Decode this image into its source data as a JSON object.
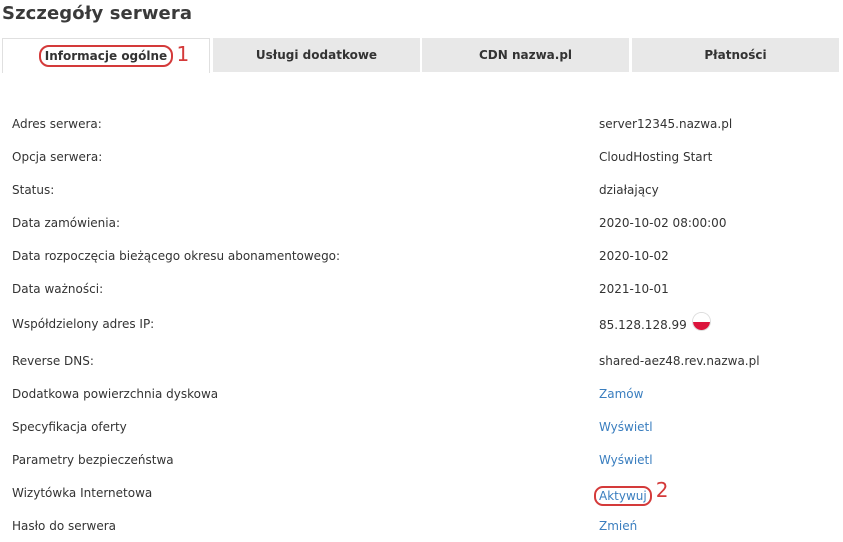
{
  "page_title": "Szczegóły serwera",
  "tabs": [
    {
      "label": "Informacje ogólne",
      "active": true,
      "marker": "1"
    },
    {
      "label": "Usługi dodatkowe",
      "active": false
    },
    {
      "label": "CDN nazwa.pl",
      "active": false
    },
    {
      "label": "Płatności",
      "active": false
    }
  ],
  "rows": [
    {
      "label": "Adres serwera:",
      "value": "server12345.nazwa.pl"
    },
    {
      "label": "Opcja serwera:",
      "value": "CloudHosting Start"
    },
    {
      "label": "Status:",
      "value": "działający"
    },
    {
      "label": "Data zamówienia:",
      "value": "2020-10-02 08:00:00"
    },
    {
      "label": "Data rozpoczęcia bieżącego okresu abonamentowego:",
      "value": "2020-10-02"
    },
    {
      "label": "Data ważności:",
      "value": "2021-10-01"
    },
    {
      "label": "Współdzielony adres IP:",
      "value": "85.128.128.99",
      "flag_icon": "poland-flag-icon"
    },
    {
      "label": "Reverse DNS:",
      "value": "shared-aez48.rev.nazwa.pl"
    },
    {
      "label": "Dodatkowa powierzchnia dyskowa",
      "link": "Zamów"
    },
    {
      "label": "Specyfikacja oferty",
      "link": "Wyświetl"
    },
    {
      "label": "Parametry bezpieczeństwa",
      "link": "Wyświetl"
    },
    {
      "label": "Wizytówka Internetowa",
      "link": "Aktywuj",
      "marker": "2"
    },
    {
      "label": "Hasło do serwera",
      "link": "Zmień"
    }
  ],
  "colors": {
    "link": "#3a7ebf",
    "highlight": "#d43a3a",
    "tab_inactive_bg": "#e8e8e8"
  }
}
